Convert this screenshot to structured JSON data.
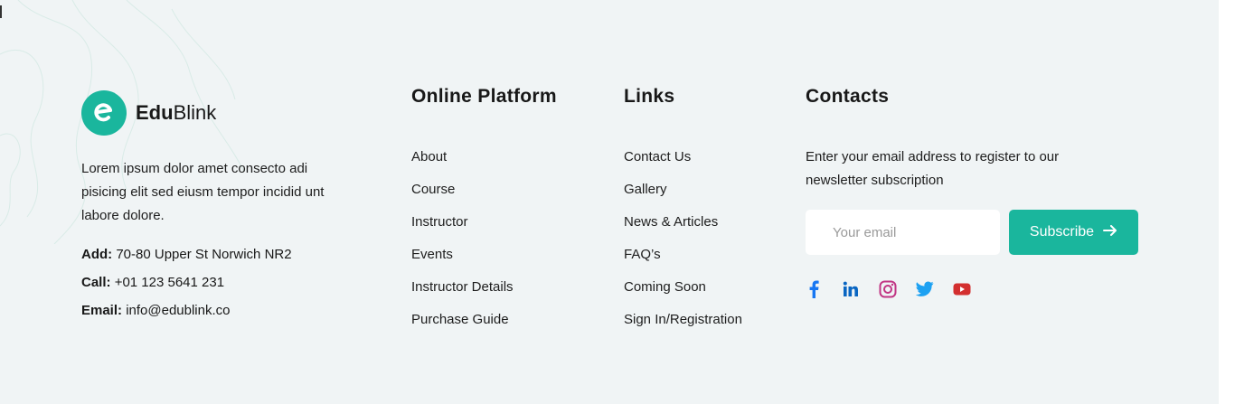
{
  "brand": {
    "name_bold": "Edu",
    "name_light": "Blink",
    "accent": "#1ab69d",
    "description": "Lorem ipsum dolor amet consecto adi pisicing elit sed eiusm tempor incidid unt labore dolore."
  },
  "contact_info": {
    "address_label": "Add:",
    "address_value": "70-80 Upper St Norwich NR2",
    "call_label": "Call:",
    "call_value": "+01 123 5641 231",
    "email_label": "Email:",
    "email_value": "info@edublink.co"
  },
  "online_platform": {
    "title": "Online Platform",
    "links": [
      "About",
      "Course",
      "Instructor",
      "Events",
      "Instructor Details",
      "Purchase Guide"
    ]
  },
  "links": {
    "title": "Links",
    "links": [
      "Contact Us",
      "Gallery",
      "News & Articles",
      "FAQ’s",
      "Coming Soon",
      "Sign In/Registration"
    ]
  },
  "contacts": {
    "title": "Contacts",
    "newsletter_text": "Enter your email address to register to our newsletter subscription",
    "email_placeholder": "Your email",
    "subscribe_label": "Subscribe",
    "social_icons": [
      {
        "name": "facebook-icon",
        "color": "#1877f2"
      },
      {
        "name": "linkedin-icon",
        "color": "#0a66c2"
      },
      {
        "name": "instagram-icon",
        "color": "#c13584"
      },
      {
        "name": "twitter-icon",
        "color": "#1da1f2"
      },
      {
        "name": "youtube-icon",
        "color": "#d32f2f"
      }
    ]
  }
}
